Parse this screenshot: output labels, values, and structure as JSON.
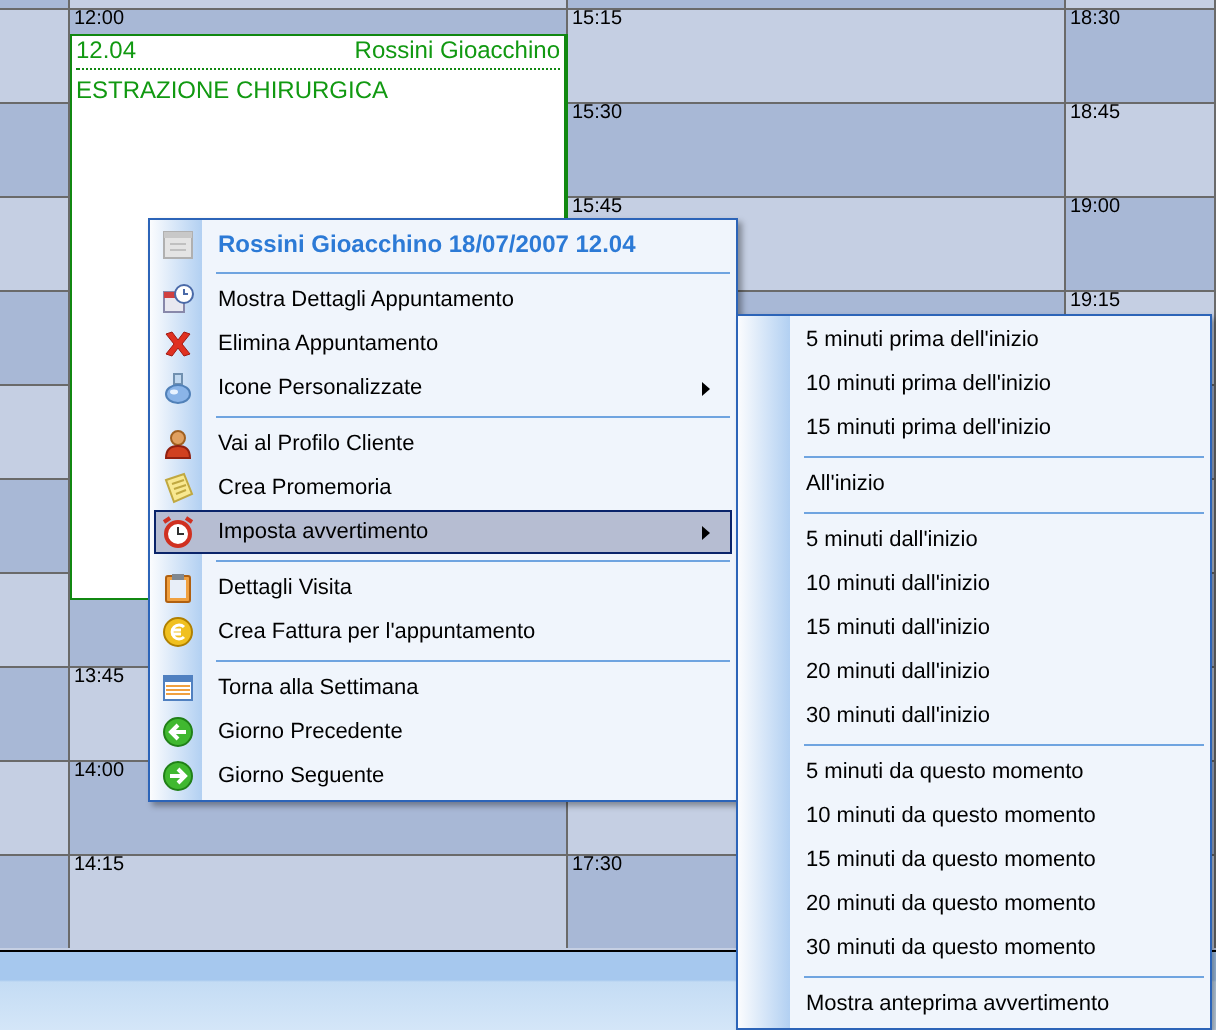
{
  "calendar": {
    "columns": [
      {
        "slots": [
          {
            "kind": "slot"
          },
          {
            "kind": "slot"
          },
          {
            "kind": "slot"
          },
          {
            "kind": "slot"
          },
          {
            "kind": "slot"
          },
          {
            "kind": "slot"
          },
          {
            "kind": "slot"
          },
          {
            "kind": "slot"
          },
          {
            "kind": "slot"
          },
          {
            "kind": "slot"
          }
        ]
      },
      {
        "slots": [
          {
            "kind": "slot",
            "time": "12:00"
          },
          {
            "kind": "appointment",
            "time": "12.04",
            "patient": "Rossini Gioacchino",
            "description": "ESTRAZIONE CHIRURGICA"
          },
          {
            "kind": "slot"
          },
          {
            "kind": "slot",
            "time": "13:45"
          },
          {
            "kind": "slot",
            "time": "14:00"
          },
          {
            "kind": "slot",
            "time": "14:15"
          }
        ]
      },
      {
        "slots": [
          {
            "kind": "slot",
            "time": "15:15"
          },
          {
            "kind": "slot",
            "time": "15:30"
          },
          {
            "kind": "slot",
            "time": "15:45"
          },
          {
            "kind": "slot"
          },
          {
            "kind": "slot"
          },
          {
            "kind": "slot",
            "time": "17:30"
          }
        ]
      },
      {
        "slots": [
          {
            "kind": "slot",
            "time": "18:30"
          },
          {
            "kind": "slot",
            "time": "18:45"
          },
          {
            "kind": "slot",
            "time": "19:00"
          },
          {
            "kind": "slot",
            "time": "19:15"
          },
          {
            "kind": "slot"
          },
          {
            "kind": "slot"
          },
          {
            "kind": "slot"
          },
          {
            "kind": "slot"
          },
          {
            "kind": "slot"
          },
          {
            "kind": "slot"
          }
        ]
      }
    ]
  },
  "context_menu": {
    "items": [
      {
        "kind": "title",
        "label": "Rossini Gioacchino 18/07/2007 12.04"
      },
      {
        "kind": "separator"
      },
      {
        "kind": "item",
        "label": "Mostra Dettagli Appuntamento",
        "selected": false,
        "submenu": false
      },
      {
        "kind": "item",
        "label": "Elimina Appuntamento",
        "selected": false,
        "submenu": false
      },
      {
        "kind": "item",
        "label": "Icone Personalizzate",
        "selected": false,
        "submenu": true
      },
      {
        "kind": "separator"
      },
      {
        "kind": "item",
        "label": "Vai al Profilo Cliente",
        "selected": false,
        "submenu": false
      },
      {
        "kind": "item",
        "label": "Crea Promemoria",
        "selected": false,
        "submenu": false
      },
      {
        "kind": "item",
        "label": "Imposta avvertimento",
        "selected": true,
        "submenu": true
      },
      {
        "kind": "separator"
      },
      {
        "kind": "item",
        "label": "Dettagli Visita",
        "selected": false,
        "submenu": false
      },
      {
        "kind": "item",
        "label": "Crea Fattura per l'appuntamento",
        "selected": false,
        "submenu": false
      },
      {
        "kind": "separator"
      },
      {
        "kind": "item",
        "label": "Torna alla Settimana",
        "selected": false,
        "submenu": false
      },
      {
        "kind": "item",
        "label": "Giorno Precedente",
        "selected": false,
        "submenu": false
      },
      {
        "kind": "item",
        "label": "Giorno Seguente",
        "selected": false,
        "submenu": false
      }
    ]
  },
  "submenu": {
    "items": [
      {
        "kind": "item",
        "label": "5 minuti prima dell'inizio",
        "selected": false
      },
      {
        "kind": "item",
        "label": "10 minuti prima dell'inizio",
        "selected": false
      },
      {
        "kind": "item",
        "label": "15 minuti prima dell'inizio",
        "selected": false
      },
      {
        "kind": "separator"
      },
      {
        "kind": "item",
        "label": "All'inizio",
        "selected": false
      },
      {
        "kind": "separator"
      },
      {
        "kind": "item",
        "label": "5 minuti dall'inizio",
        "selected": false
      },
      {
        "kind": "item",
        "label": "10 minuti dall'inizio",
        "selected": false
      },
      {
        "kind": "item",
        "label": "15 minuti dall'inizio",
        "selected": false
      },
      {
        "kind": "item",
        "label": "20 minuti dall'inizio",
        "selected": false
      },
      {
        "kind": "item",
        "label": "30 minuti dall'inizio",
        "selected": false
      },
      {
        "kind": "separator"
      },
      {
        "kind": "item",
        "label": "5 minuti da questo momento",
        "selected": false
      },
      {
        "kind": "item",
        "label": "10 minuti da questo momento",
        "selected": false
      },
      {
        "kind": "item",
        "label": "15 minuti da questo momento",
        "selected": false
      },
      {
        "kind": "item",
        "label": "20 minuti da questo momento",
        "selected": false
      },
      {
        "kind": "item",
        "label": "30 minuti da questo momento",
        "selected": false
      },
      {
        "kind": "separator"
      },
      {
        "kind": "item",
        "label": "Mostra anteprima avvertimento",
        "selected": false
      }
    ]
  }
}
